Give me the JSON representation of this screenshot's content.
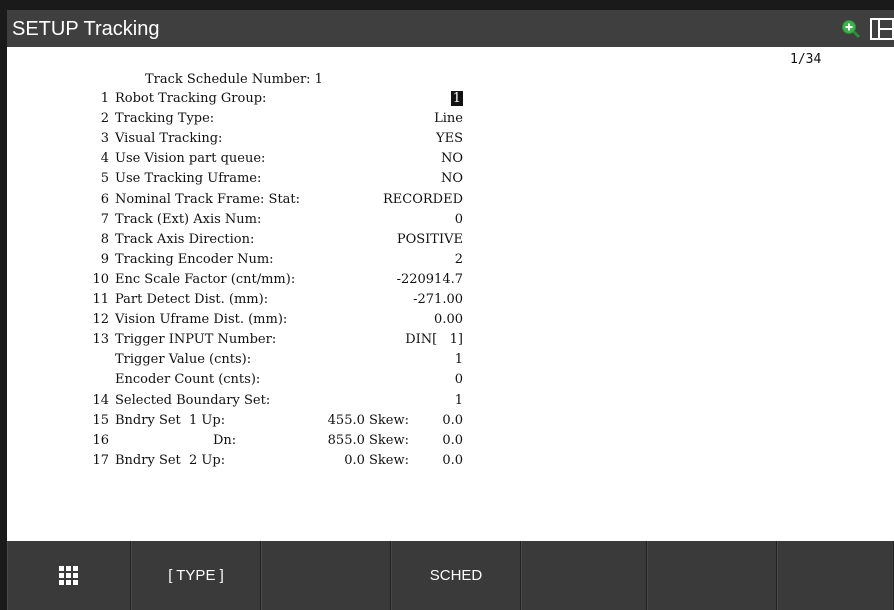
{
  "title": "SETUP Tracking",
  "page_indicator": "1/34",
  "schedule_title": "Track Schedule Number: 1",
  "rows": [
    {
      "num": "1",
      "label": "Robot Tracking Group:",
      "value": "1",
      "cursor": true
    },
    {
      "num": "2",
      "label": "Tracking Type:",
      "value": "Line"
    },
    {
      "num": "3",
      "label": "Visual Tracking:",
      "value": "YES"
    },
    {
      "num": "4",
      "label": "Use Vision part queue:",
      "value": "NO"
    },
    {
      "num": "5",
      "label": "Use Tracking Uframe:",
      "value": "NO"
    },
    {
      "num": "6",
      "label": "Nominal Track Frame: Stat:",
      "value": "RECORDED"
    },
    {
      "num": "7",
      "label": "Track (Ext) Axis Num:",
      "value": "0"
    },
    {
      "num": "8",
      "label": "Track Axis Direction:",
      "value": "POSITIVE"
    },
    {
      "num": "9",
      "label": "Tracking Encoder Num:",
      "value": "2"
    },
    {
      "num": "10",
      "label": "Enc Scale Factor (cnt/mm):",
      "value": "-220914.7"
    },
    {
      "num": "11",
      "label": "Part Detect Dist. (mm):",
      "value": "-271.00"
    },
    {
      "num": "12",
      "label": "Vision Uframe Dist. (mm):",
      "value": "0.00"
    },
    {
      "num": "13",
      "label": "Trigger INPUT Number:",
      "value": "DIN[   1]"
    },
    {
      "num": "",
      "label": "Trigger Value (cnts):",
      "value": "1"
    },
    {
      "num": "",
      "label": "Encoder Count (cnts):",
      "value": "0"
    },
    {
      "num": "14",
      "label": "Selected Boundary Set:",
      "value": "1"
    }
  ],
  "boundary_rows": [
    {
      "num": "15",
      "label": "Bndry Set  1 Up:",
      "up": "455.0 Skew:",
      "skew": "0.0"
    },
    {
      "num": "16",
      "label": "Dn:",
      "up": "855.0 Skew:",
      "skew": "0.0"
    },
    {
      "num": "17",
      "label": "Bndry Set  2 Up:",
      "up": "0.0 Skew:",
      "skew": "0.0"
    }
  ],
  "softkeys": [
    {
      "label": "",
      "icon": "grid-icon"
    },
    {
      "label": "[ TYPE ]"
    },
    {
      "label": ""
    },
    {
      "label": "SCHED"
    },
    {
      "label": ""
    },
    {
      "label": ""
    },
    {
      "label": ""
    }
  ],
  "icons": {
    "zoom": "zoom-in-icon",
    "split": "split-screen-icon"
  },
  "colors": {
    "titlebar": "#3f3f3f",
    "softkey_bar": "#3a3a3a",
    "zoom_icon": "#3cb34a"
  }
}
